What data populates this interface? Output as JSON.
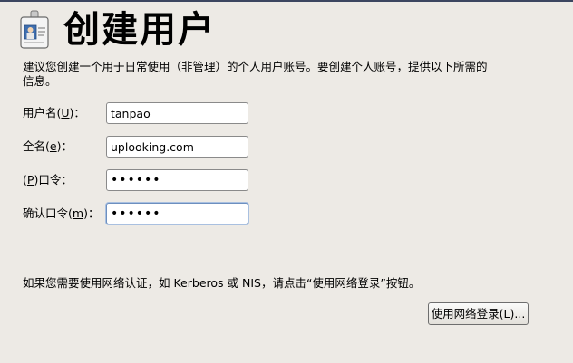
{
  "header": {
    "title": "创建用户",
    "icon": "user-badge-icon"
  },
  "intro": {
    "text": "建议您创建一个用于日常使用（非管理）的个人用户账号。要创建个人账号，提供以下所需的信息。"
  },
  "fields": {
    "username": {
      "label_prefix": "用户名(",
      "label_mnemonic": "U",
      "label_suffix": ")：",
      "value": "tanpao"
    },
    "fullname": {
      "label_prefix": "全名(",
      "label_mnemonic": "e",
      "label_suffix": ")：",
      "value": "uplooking.com"
    },
    "password": {
      "label_prefix": "(",
      "label_mnemonic": "P",
      "label_suffix": ")口令：",
      "value": "••••••"
    },
    "confirm_password": {
      "label_prefix": "确认口令(",
      "label_mnemonic": "m",
      "label_suffix": ")：",
      "value": "••••••"
    }
  },
  "network": {
    "hint": "如果您需要使用网络认证，如 Kerberos 或 NIS，请点击“使用网络登录”按钮。",
    "button_label": "使用网络登录(L)..."
  }
}
